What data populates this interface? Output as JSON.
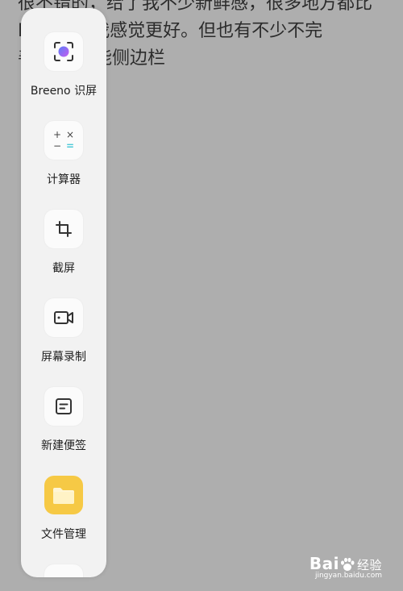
{
  "background_text": {
    "line1": "很不错的，给了我不少新鲜感，很多地方都比",
    "line2": "B          MIUI给我感觉更好。但也有不少不完",
    "line3": "善          比如智能侧边栏"
  },
  "sidebar": {
    "items": [
      {
        "label": "Breeno 识屏",
        "icon": "breeno-scan-icon"
      },
      {
        "label": "计算器",
        "icon": "calculator-icon"
      },
      {
        "label": "截屏",
        "icon": "crop-screenshot-icon"
      },
      {
        "label": "屏幕录制",
        "icon": "screen-record-icon"
      },
      {
        "label": "新建便签",
        "icon": "note-icon"
      },
      {
        "label": "文件管理",
        "icon": "folder-icon"
      },
      {
        "label": "",
        "icon": ""
      }
    ]
  },
  "watermark": {
    "brand": "Bai",
    "brand_suffix": "经验",
    "url": "jingyan.baidu.com"
  },
  "colors": {
    "background": "#aeaeae",
    "sidebar": "#f2f2f2",
    "folder": "#f6c945",
    "breeno_purple": "#9b5cf0",
    "calc_accent": "#4cc9d8"
  }
}
